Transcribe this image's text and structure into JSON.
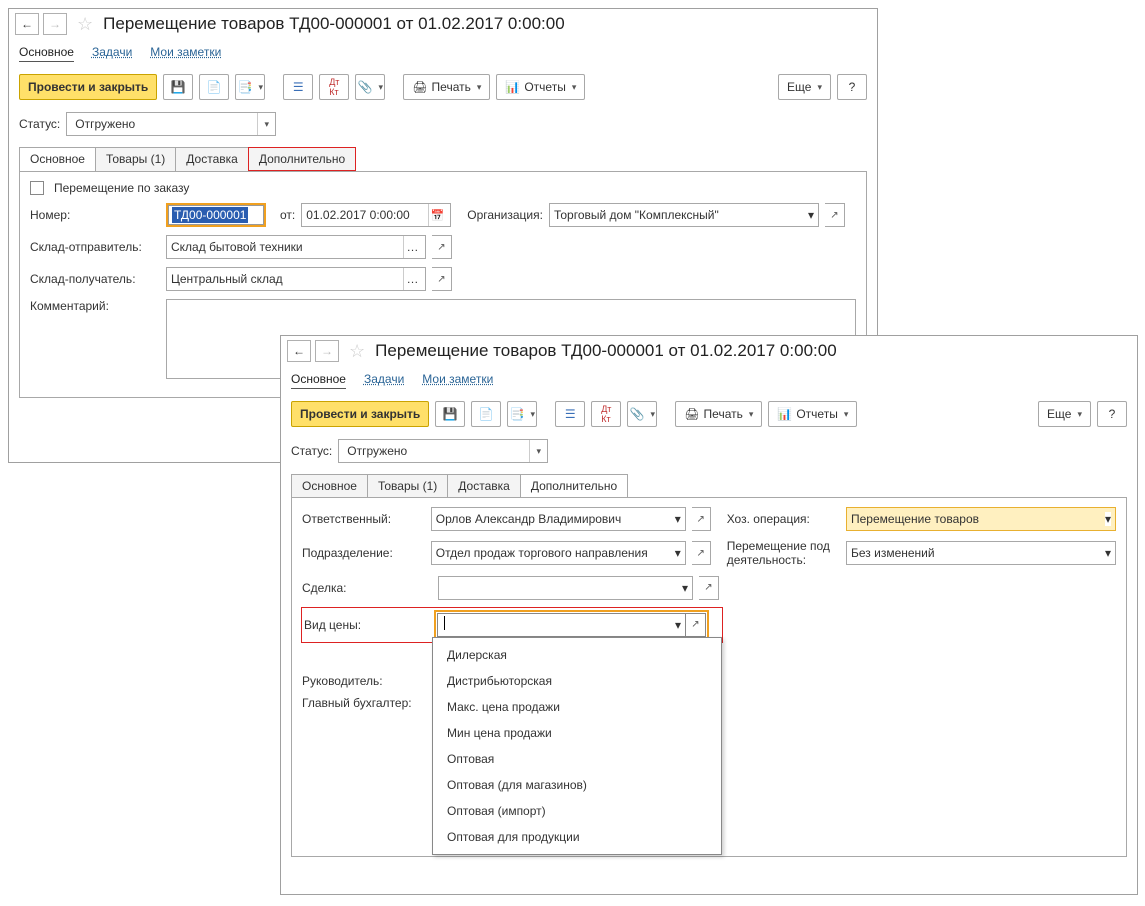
{
  "window1": {
    "title": "Перемещение товаров ТД00-000001 от 01.02.2017 0:00:00",
    "navlinks": {
      "main": "Основное",
      "tasks": "Задачи",
      "notes": "Мои заметки"
    },
    "toolbar": {
      "post_close": "Провести и закрыть",
      "print": "Печать",
      "reports": "Отчеты",
      "more": "Еще",
      "help": "?"
    },
    "status_label": "Статус:",
    "status_value": "Отгружено",
    "tabs": {
      "main": "Основное",
      "goods": "Товары (1)",
      "delivery": "Доставка",
      "extra": "Дополнительно"
    },
    "fields": {
      "by_order": "Перемещение по заказу",
      "number_label": "Номер:",
      "number_value": "ТД00-000001",
      "from_label": "от:",
      "date_value": "01.02.2017  0:00:00",
      "org_label": "Организация:",
      "org_value": "Торговый дом \"Комплексный\"",
      "sender_label": "Склад-отправитель:",
      "sender_value": "Склад бытовой техники",
      "receiver_label": "Склад-получатель:",
      "receiver_value": "Центральный склад",
      "comment_label": "Комментарий:"
    }
  },
  "window2": {
    "title": "Перемещение товаров ТД00-000001 от 01.02.2017 0:00:00",
    "navlinks": {
      "main": "Основное",
      "tasks": "Задачи",
      "notes": "Мои заметки"
    },
    "toolbar": {
      "post_close": "Провести и закрыть",
      "print": "Печать",
      "reports": "Отчеты",
      "more": "Еще",
      "help": "?"
    },
    "status_label": "Статус:",
    "status_value": "Отгружено",
    "tabs": {
      "main": "Основное",
      "goods": "Товары (1)",
      "delivery": "Доставка",
      "extra": "Дополнительно"
    },
    "fields": {
      "responsible_label": "Ответственный:",
      "responsible_value": "Орлов Александр Владимирович",
      "operation_label": "Хоз. операция:",
      "operation_value": "Перемещение товаров",
      "dept_label": "Подразделение:",
      "dept_value": "Отдел продаж торгового направления",
      "move_under_label": "Перемещение под деятельность:",
      "move_under_value": "Без изменений",
      "deal_label": "Сделка:",
      "price_type_label": "Вид цены:",
      "manager_label": "Руководитель:",
      "chief_acc_label": "Главный бухгалтер:"
    },
    "dropdown": {
      "items": [
        "Дилерская",
        "Дистрибьюторская",
        "Макс. цена продажи",
        "Мин цена продажи",
        "Оптовая",
        "Оптовая (для магазинов)",
        "Оптовая (импорт)",
        "Оптовая для продукции"
      ]
    }
  }
}
